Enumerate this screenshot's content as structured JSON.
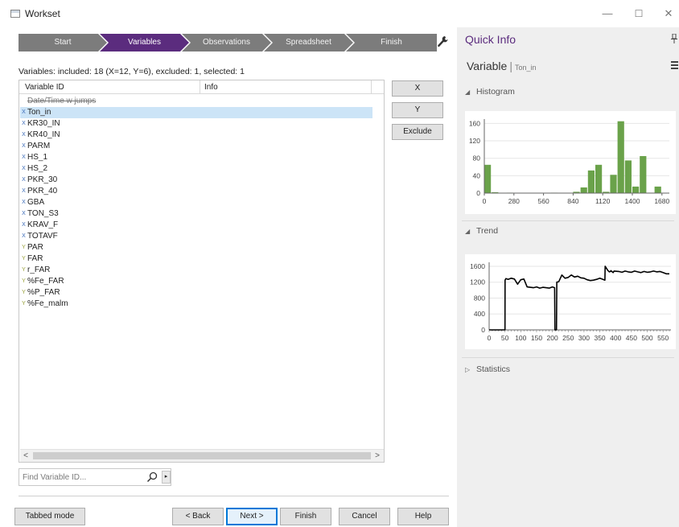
{
  "window": {
    "title": "Workset",
    "minimize": "—",
    "maximize": "☐",
    "close": "✕"
  },
  "wizard": {
    "steps": [
      {
        "label": "Start",
        "active": false
      },
      {
        "label": "Variables",
        "active": true
      },
      {
        "label": "Observations",
        "active": false
      },
      {
        "label": "Spreadsheet",
        "active": false
      },
      {
        "label": "Finish",
        "active": false
      }
    ],
    "settings_icon": "wrench-icon"
  },
  "summary": "Variables: included: 18 (X=12, Y=6), excluded: 1, selected: 1",
  "grid": {
    "columns": [
      "Variable ID",
      "Info"
    ],
    "rows": [
      {
        "type": "",
        "id": "Date/Time w jumps",
        "excluded": true,
        "selected": false
      },
      {
        "type": "X",
        "id": "Ton_in",
        "excluded": false,
        "selected": true
      },
      {
        "type": "X",
        "id": "KR30_IN",
        "excluded": false,
        "selected": false
      },
      {
        "type": "X",
        "id": "KR40_IN",
        "excluded": false,
        "selected": false
      },
      {
        "type": "X",
        "id": "PARM",
        "excluded": false,
        "selected": false
      },
      {
        "type": "X",
        "id": "HS_1",
        "excluded": false,
        "selected": false
      },
      {
        "type": "X",
        "id": "HS_2",
        "excluded": false,
        "selected": false
      },
      {
        "type": "X",
        "id": "PKR_30",
        "excluded": false,
        "selected": false
      },
      {
        "type": "X",
        "id": "PKR_40",
        "excluded": false,
        "selected": false
      },
      {
        "type": "X",
        "id": "GBA",
        "excluded": false,
        "selected": false
      },
      {
        "type": "X",
        "id": "TON_S3",
        "excluded": false,
        "selected": false
      },
      {
        "type": "X",
        "id": "KRAV_F",
        "excluded": false,
        "selected": false
      },
      {
        "type": "X",
        "id": "TOTAVF",
        "excluded": false,
        "selected": false
      },
      {
        "type": "Y",
        "id": "PAR",
        "excluded": false,
        "selected": false
      },
      {
        "type": "Y",
        "id": "FAR",
        "excluded": false,
        "selected": false
      },
      {
        "type": "Y",
        "id": "r_FAR",
        "excluded": false,
        "selected": false
      },
      {
        "type": "Y",
        "id": "%Fe_FAR",
        "excluded": false,
        "selected": false
      },
      {
        "type": "Y",
        "id": "%P_FAR",
        "excluded": false,
        "selected": false
      },
      {
        "type": "Y",
        "id": "%Fe_malm",
        "excluded": false,
        "selected": false
      }
    ],
    "scroll_left": "<",
    "scroll_right": ">"
  },
  "side_buttons": {
    "x": "X",
    "y": "Y",
    "exclude": "Exclude"
  },
  "search": {
    "placeholder": "Find Variable ID...",
    "value": "",
    "dropdown": "▸"
  },
  "footer": {
    "tabbed_mode": "Tabbed mode",
    "back": "< Back",
    "next": "Next >",
    "finish": "Finish",
    "cancel": "Cancel",
    "help": "Help"
  },
  "quick_info": {
    "title": "Quick Info",
    "pin_icon": "pin-icon",
    "variable_label": "Variable",
    "variable_name": "Ton_in",
    "histogram_label": "Histogram",
    "trend_label": "Trend",
    "statistics_label": "Statistics",
    "expanded_marker": "◢",
    "collapsed_marker": "▷"
  },
  "chart_data": [
    {
      "type": "bar",
      "name": "histogram",
      "bar_color": "#6aa24a",
      "bin_width": 70,
      "bins_start": [
        0,
        70,
        140,
        210,
        280,
        350,
        420,
        490,
        560,
        630,
        700,
        770,
        840,
        910,
        980,
        1050,
        1120,
        1190,
        1260,
        1330,
        1400,
        1470,
        1540,
        1610,
        1680
      ],
      "values": [
        65,
        2,
        0,
        1,
        0,
        0,
        0,
        0,
        0,
        1,
        0,
        0,
        3,
        13,
        52,
        65,
        3,
        42,
        165,
        75,
        15,
        85,
        1,
        15,
        0
      ],
      "xticks": [
        0,
        280,
        560,
        840,
        1120,
        1400,
        1680
      ],
      "yticks": [
        0,
        40,
        80,
        120,
        160
      ],
      "xlim": [
        0,
        1750
      ],
      "ylim": [
        0,
        170
      ]
    },
    {
      "type": "line",
      "name": "trend",
      "line_color": "#000000",
      "x": [
        0,
        50,
        50.5,
        53,
        60,
        70,
        80,
        90,
        100,
        110,
        120,
        130,
        140,
        150,
        160,
        170,
        180,
        190,
        200,
        207,
        208,
        213,
        214,
        220,
        230,
        240,
        250,
        260,
        270,
        280,
        290,
        300,
        310,
        320,
        330,
        340,
        350,
        360,
        366,
        367,
        375,
        380,
        384,
        385,
        392,
        395,
        410,
        420,
        430,
        440,
        450,
        460,
        470,
        480,
        490,
        500,
        510,
        520,
        530,
        540,
        550,
        560,
        570
      ],
      "y": [
        0,
        0,
        1250,
        1290,
        1270,
        1300,
        1280,
        1150,
        1260,
        1280,
        1080,
        1070,
        1060,
        1080,
        1050,
        1070,
        1060,
        1050,
        1080,
        1060,
        0,
        0,
        1200,
        1210,
        1380,
        1300,
        1320,
        1380,
        1330,
        1350,
        1310,
        1300,
        1260,
        1240,
        1250,
        1270,
        1300,
        1270,
        1250,
        1600,
        1500,
        1460,
        1470,
        1490,
        1440,
        1480,
        1470,
        1450,
        1480,
        1460,
        1450,
        1480,
        1460,
        1440,
        1470,
        1450,
        1460,
        1480,
        1460,
        1470,
        1440,
        1410,
        1410
      ],
      "xticks": [
        0,
        50,
        100,
        150,
        200,
        250,
        300,
        350,
        400,
        450,
        500,
        550
      ],
      "yticks": [
        0,
        400,
        800,
        1200,
        1600
      ],
      "xlim": [
        0,
        575
      ],
      "ylim": [
        0,
        1700
      ]
    }
  ]
}
